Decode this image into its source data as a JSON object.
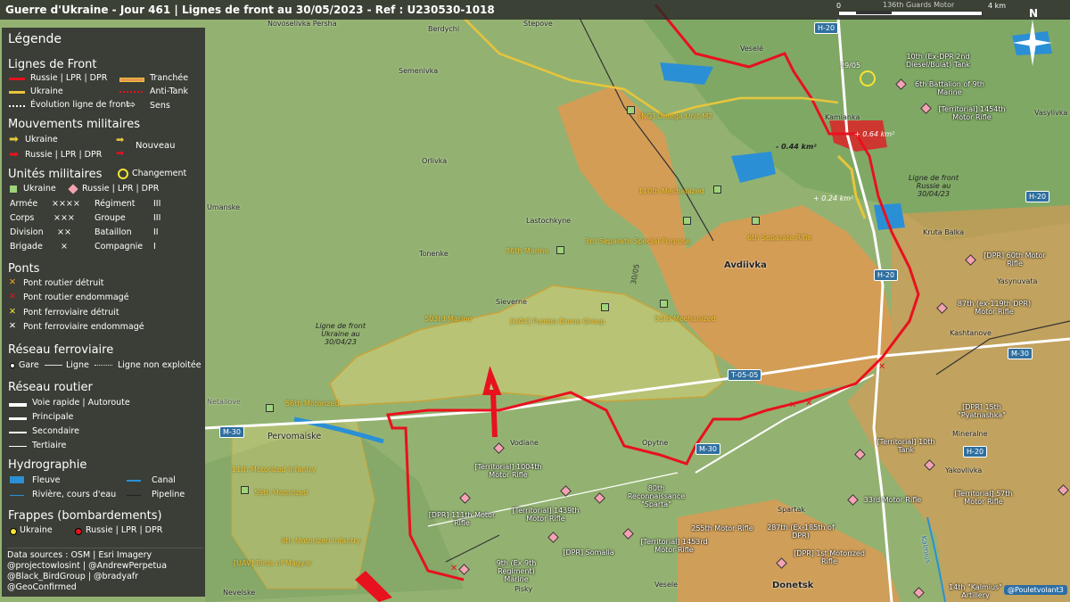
{
  "title": "Guerre d'Ukraine - Jour 461 | Lignes de front au 30/05/2023 - Ref : U230530-1018",
  "scale": {
    "zero": "0",
    "max": "4 km",
    "over_label": "136th Guards Motor"
  },
  "compass": "N",
  "colors": {
    "russia": "#e8111e",
    "ukraine": "#e8c53b",
    "russia_zone": "#e8964e",
    "ukraine_zone": "#e6d77a",
    "water": "#2b8fd6",
    "road_badge": "#2f6f9f"
  },
  "legend": {
    "title": "Légende",
    "front_lines": {
      "heading": "Lignes de Front",
      "russia": "Russie | LPR | DPR",
      "ukraine": "Ukraine",
      "trench": "Tranchée",
      "anti_tank": "Anti-Tank",
      "evolution": "Évolution ligne de front",
      "direction": "Sens"
    },
    "movements": {
      "heading": "Mouvements militaires",
      "ukraine": "Ukraine",
      "russia": "Russie | LPR | DPR",
      "new": "Nouveau"
    },
    "units": {
      "heading": "Unités militaires",
      "change": "Changement",
      "ukraine": "Ukraine",
      "russia": "Russie | LPR | DPR",
      "rows": [
        {
          "a": "Armée",
          "as": "××××",
          "b": "Régiment",
          "bs": "III"
        },
        {
          "a": "Corps",
          "as": "×××",
          "b": "Groupe",
          "bs": "III"
        },
        {
          "a": "Division",
          "as": "××",
          "b": "Bataillon",
          "bs": "II"
        },
        {
          "a": "Brigade",
          "as": "×",
          "b": "Compagnie",
          "bs": "I"
        }
      ]
    },
    "bridges": {
      "heading": "Ponts",
      "items": [
        "Pont routier détruit",
        "Pont routier endommagé",
        "Pont ferroviaire détruit",
        "Pont ferroviaire endommagé"
      ]
    },
    "rail": {
      "heading": "Réseau ferroviaire",
      "station": "Gare",
      "line": "Ligne",
      "unused": "Ligne non exploitée"
    },
    "roads": {
      "heading": "Réseau routier",
      "items": [
        "Voie rapide | Autoroute",
        "Principale",
        "Secondaire",
        "Tertiaire"
      ]
    },
    "hydro": {
      "heading": "Hydrographie",
      "river_big": "Fleuve",
      "canal": "Canal",
      "river": "Rivière, cours d'eau",
      "pipeline": "Pipeline"
    },
    "strikes": {
      "heading": "Frappes (bombardements)",
      "ukraine": "Ukraine",
      "russia": "Russie | LPR | DPR"
    },
    "sources": [
      "Data sources : OSM | Esri Imagery",
      "@projectowlosint | @AndrewPerpetua",
      "@Black_BirdGroup | @bradyafr",
      "@GeoConfirmed"
    ]
  },
  "towns": [
    "Novoselivka Persha",
    "Berdychi",
    "Stepove",
    "Veselé",
    "Semenivka",
    "Orlivka",
    "Umanske",
    "Lastochkyne",
    "Tonenke",
    "Sieverne",
    "Avdiivka",
    "Kamianka",
    "Kruta Balka",
    "Yasynuvata",
    "Kashtanove",
    "Vasylivka",
    "Pervomaiske",
    "Vodiane",
    "Opytne",
    "Spartak",
    "Mineralne",
    "Yakovlivka",
    "Netailove",
    "Nevelske",
    "Pisky",
    "Vesele",
    "Donetsk",
    "Kalmius"
  ],
  "roads": [
    "H-20",
    "H-20",
    "H-20",
    "H-20",
    "M-30",
    "M-30",
    "M-30",
    "T-05-05",
    "M-30",
    "T-05-05"
  ],
  "ukr_units": [
    "[NG] Omega Unit M2",
    "110th Mechanized",
    "3rd Separate Special Purpose",
    "6th Separate Rifle",
    "36th Marine",
    "503rd Marine",
    "[UAV] Pumba Drone Group",
    "53rd Mechanized",
    "56th Motorized",
    "11th Motorized Infantry",
    "59th Motorized",
    "9th Motorized Infantry",
    "[UAV] Birds of Magyar"
  ],
  "rus_units": [
    "10th (Ex-DPR 2nd Diesel/Bulat) Tank",
    "6th Battalion of 9th Marine",
    "[Territorial] 1454th Motor Rifle",
    "[DPR] 60th Motor Rifle",
    "87th (ex-119th DPR) Motor Rifle",
    "[DPR] 15th \"Pyatnashka\"",
    "[Territorial] 10th Tank",
    "33rd Motor Rifle",
    "[Territorial] 57th Motor Rifle",
    "[Territorial] 1004th Motor Rifle",
    "[DPR] 111th Motor Rifle",
    "[Territorial] 1439th Motor Rifle",
    "80th Reconnaissance \"Sparta\"",
    "255th Motor Rifle",
    "287th (Ex-185th of DPR)",
    "[Territorial] 1453rd Motor Rifle",
    "[DPR] Somalia",
    "9th (Ex 9th Regiment) Marine",
    "[DPR] 1st Motorized Rifle",
    "14th \"Kalmius\" Artillery"
  ],
  "annotations": {
    "date": "29/05",
    "gain": "+ 0.64 km²",
    "loss": "- 0.44 km²",
    "ukr_gain": "+ 0.24 km²",
    "ru_front_label": "Ligne de front Russie au 30/04/23",
    "ua_front_label": "Ligne de front Ukraine au 30/04/23",
    "grid_ref": "30/05"
  },
  "credit": "@Pouletvolant3"
}
